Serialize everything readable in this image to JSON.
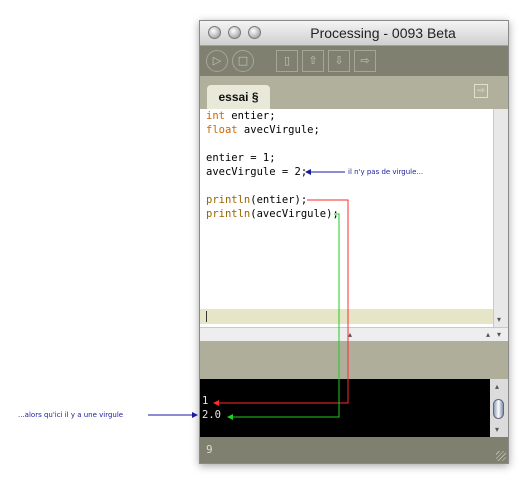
{
  "window": {
    "title": "Processing - 0093 Beta"
  },
  "toolbar": {
    "buttons": [
      {
        "icon": "play-icon"
      },
      {
        "icon": "stop-icon"
      },
      {
        "icon": "new-icon"
      },
      {
        "icon": "open-icon"
      },
      {
        "icon": "save-icon"
      },
      {
        "icon": "export-icon"
      }
    ]
  },
  "tabs": [
    {
      "label": "essai §"
    }
  ],
  "editor": {
    "lines": [
      {
        "kw": "int",
        "rest": " entier;"
      },
      {
        "kw": "float",
        "rest": " avecVirgule;"
      },
      {
        "kw": "",
        "rest": ""
      },
      {
        "kw": "",
        "rest": "entier = 1;"
      },
      {
        "kw": "",
        "rest": "avecVirgule = 2;"
      },
      {
        "kw": "",
        "rest": ""
      },
      {
        "fn": "println",
        "rest": "(entier);"
      },
      {
        "fn": "println",
        "rest": "(avecVirgule);"
      }
    ]
  },
  "console": {
    "lines": [
      "1",
      "2.0"
    ]
  },
  "footer": {
    "line_number": "9"
  },
  "annotations": {
    "no_comma": "il n'y pas de virgule...",
    "comma": "...alors qu'ici il y a une virgule"
  },
  "colors": {
    "annotation_blue": "#1a1aa0",
    "arrow_red": "#ff2a2a",
    "arrow_green": "#22cc22"
  }
}
